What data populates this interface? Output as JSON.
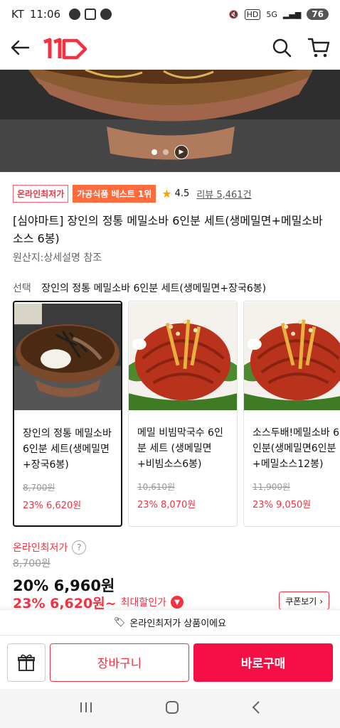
{
  "status_bar": {
    "carrier": "KT",
    "time": "11:06",
    "battery": "76",
    "network": "5G"
  },
  "header": {
    "logo_text": "11"
  },
  "hero": {
    "slide_count": 2,
    "active_slide": 1
  },
  "badges": {
    "lowest": "온라인최저가",
    "best": "가공식품 베스트 1위"
  },
  "rating": {
    "score": "4.5",
    "reviews": "리뷰 5,461건"
  },
  "product": {
    "title": "[심야마트] 장인의 정통 메밀소바 6인분 세트(생메밀면+메밀소바소스 6봉)",
    "origin": "원산지:상세설명 참조"
  },
  "selection": {
    "label": "선택",
    "value": "장인의 정통 메밀소바 6인분 세트(생메밀면+장국6봉)"
  },
  "options": [
    {
      "name": "장인의 정통 메밀소바 6인분 세트(생메밀면+장국6봉)",
      "original": "8,700원",
      "sale": "23% 6,620원",
      "selected": true
    },
    {
      "name": "메밀 비빔막국수 6인분 세트 (생메밀면+비빔소스6봉)",
      "original": "10,610원",
      "sale": "23% 8,070원",
      "selected": false
    },
    {
      "name": "소스두배!메밀소바 6인분(생메밀면6인분+메밀소스12봉)",
      "original": "11,900원",
      "sale": "23% 9,050원",
      "selected": false
    }
  ],
  "price": {
    "label": "온라인최저가",
    "help": "?",
    "original": "8,700원",
    "sale": "20% 6,960원",
    "max_amount": "23% 6,620원~",
    "max_label": "최대할인가",
    "coupon": "쿠폰보기"
  },
  "notice": {
    "icon": "🏷",
    "text": "온라인최저가 상품이에요"
  },
  "actions": {
    "cart": "장바구니",
    "buy": "바로구매"
  },
  "colors": {
    "accent": "#f43142",
    "best_badge": "#ff6b3d",
    "buy": "#f40f45"
  }
}
